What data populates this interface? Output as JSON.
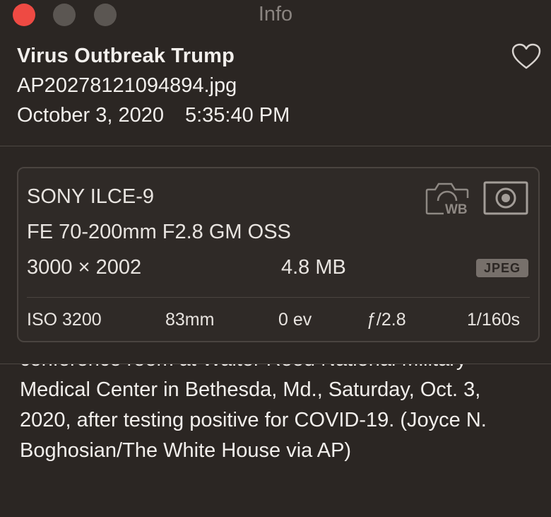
{
  "window": {
    "title": "Info"
  },
  "photo": {
    "title": "Virus Outbreak Trump",
    "filename": "AP20278121094894.jpg",
    "date": "October 3, 2020",
    "time": "5:35:40 PM",
    "favorite_icon": "heart-icon"
  },
  "camera": {
    "model": "SONY ILCE-9",
    "lens": "FE 70-200mm F2.8 GM OSS",
    "dimensions": "3000 × 2002",
    "file_size": "4.8 MB",
    "format_badge": "JPEG",
    "white_balance_icon": "camera-wb-icon",
    "metering_icon": "spot-metering-icon"
  },
  "exif": {
    "iso": "ISO 3200",
    "focal_length": "83mm",
    "exposure_bias": "0 ev",
    "aperture": "ƒ/2.8",
    "shutter_speed": "1/160s"
  },
  "caption": {
    "text": "conference room at Walter Reed National Military Medical Center in Bethesda, Md., Saturday, Oct. 3, 2020, after testing positive for COVID-19. (Joyce N. Boghosian/The White House via AP)"
  },
  "colors": {
    "background": "#2b2623",
    "close_button": "#ee4a43",
    "inactive_button": "#5b5652",
    "text": "#f2efec",
    "muted_text": "#8a8480"
  }
}
